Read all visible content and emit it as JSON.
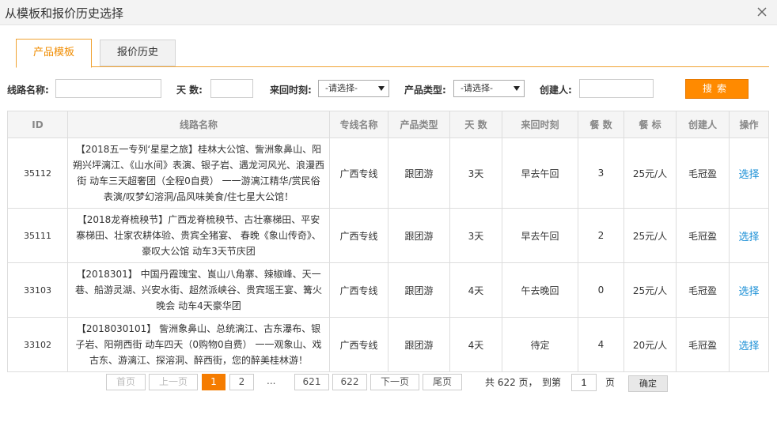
{
  "dialog": {
    "title": "从模板和报价历史选择"
  },
  "tabs": [
    {
      "label": "产品模板"
    },
    {
      "label": "报价历史"
    }
  ],
  "filter": {
    "route_label": "线路名称:",
    "days_label": "天 数:",
    "time_label": "来回时刻:",
    "time_value": "-请选择-",
    "type_label": "产品类型:",
    "type_value": "-请选择-",
    "creator_label": "创建人:",
    "search_label": "搜索"
  },
  "table": {
    "headers": [
      "ID",
      "线路名称",
      "专线名称",
      "产品类型",
      "天 数",
      "来回时刻",
      "餐 数",
      "餐 标",
      "创建人",
      "操作"
    ],
    "rows": [
      {
        "id": "35112",
        "route": "【2018五一专列‘星星之旅】桂林大公馆、訾洲象鼻山、阳朔兴坪漓江、《山水间》表演、银子岩、遇龙河风光、浪漫西街 动车三天超奢团（全程0自费） 一一游漓江精华/赏民俗表演/叹梦幻溶洞/品风味美食/住七星大公馆！",
        "line": "广西专线",
        "type": "跟团游",
        "days": "3天",
        "time": "早去午回",
        "meals": "3",
        "meal_std": "25元/人",
        "creator": "毛冠盈",
        "op": "选择"
      },
      {
        "id": "35111",
        "route": "【2018龙脊梳秧节】广西龙脊梳秧节、古壮寨梯田、平安寨梯田、壮家农耕体验、贵宾全猪宴、 春晚《象山传奇》、豪叹大公馆 动车3天节庆团",
        "line": "广西专线",
        "type": "跟团游",
        "days": "3天",
        "time": "早去午回",
        "meals": "2",
        "meal_std": "25元/人",
        "creator": "毛冠盈",
        "op": "选择"
      },
      {
        "id": "33103",
        "route": "【2018301】 中国丹霞瑰宝、崀山八角寨、辣椒峰、天一巷、船游灵湖、兴安水街、超然派峡谷、贵宾瑶王宴、篝火晚会 动车4天豪华团",
        "line": "广西专线",
        "type": "跟团游",
        "days": "4天",
        "time": "午去晚回",
        "meals": "0",
        "meal_std": "25元/人",
        "creator": "毛冠盈",
        "op": "选择"
      },
      {
        "id": "33102",
        "route": "【2018030101】 訾洲象鼻山、总统漓江、古东瀑布、银子岩、阳朔西街 动车四天（0购物0自费） 一一观象山、戏古东、游漓江、探溶洞、醉西街，您的醉美桂林游！",
        "line": "广西专线",
        "type": "跟团游",
        "days": "4天",
        "time": "待定",
        "meals": "4",
        "meal_std": "20元/人",
        "creator": "毛冠盈",
        "op": "选择"
      }
    ]
  },
  "pager": {
    "first": "首页",
    "prev": "上一页",
    "p1": "1",
    "p2": "2",
    "dots": "...",
    "p621": "621",
    "p622": "622",
    "next": "下一页",
    "last": "尾页",
    "total_text": "共 622 页，",
    "goto_text": "到第",
    "goto_value": "1",
    "page_unit": "页",
    "confirm": "确定"
  },
  "colors": {
    "accent": "#f57c00",
    "link": "#1a8fd6"
  },
  "icons": {
    "close": "close-icon",
    "dropdown": "triangle-down-icon"
  }
}
